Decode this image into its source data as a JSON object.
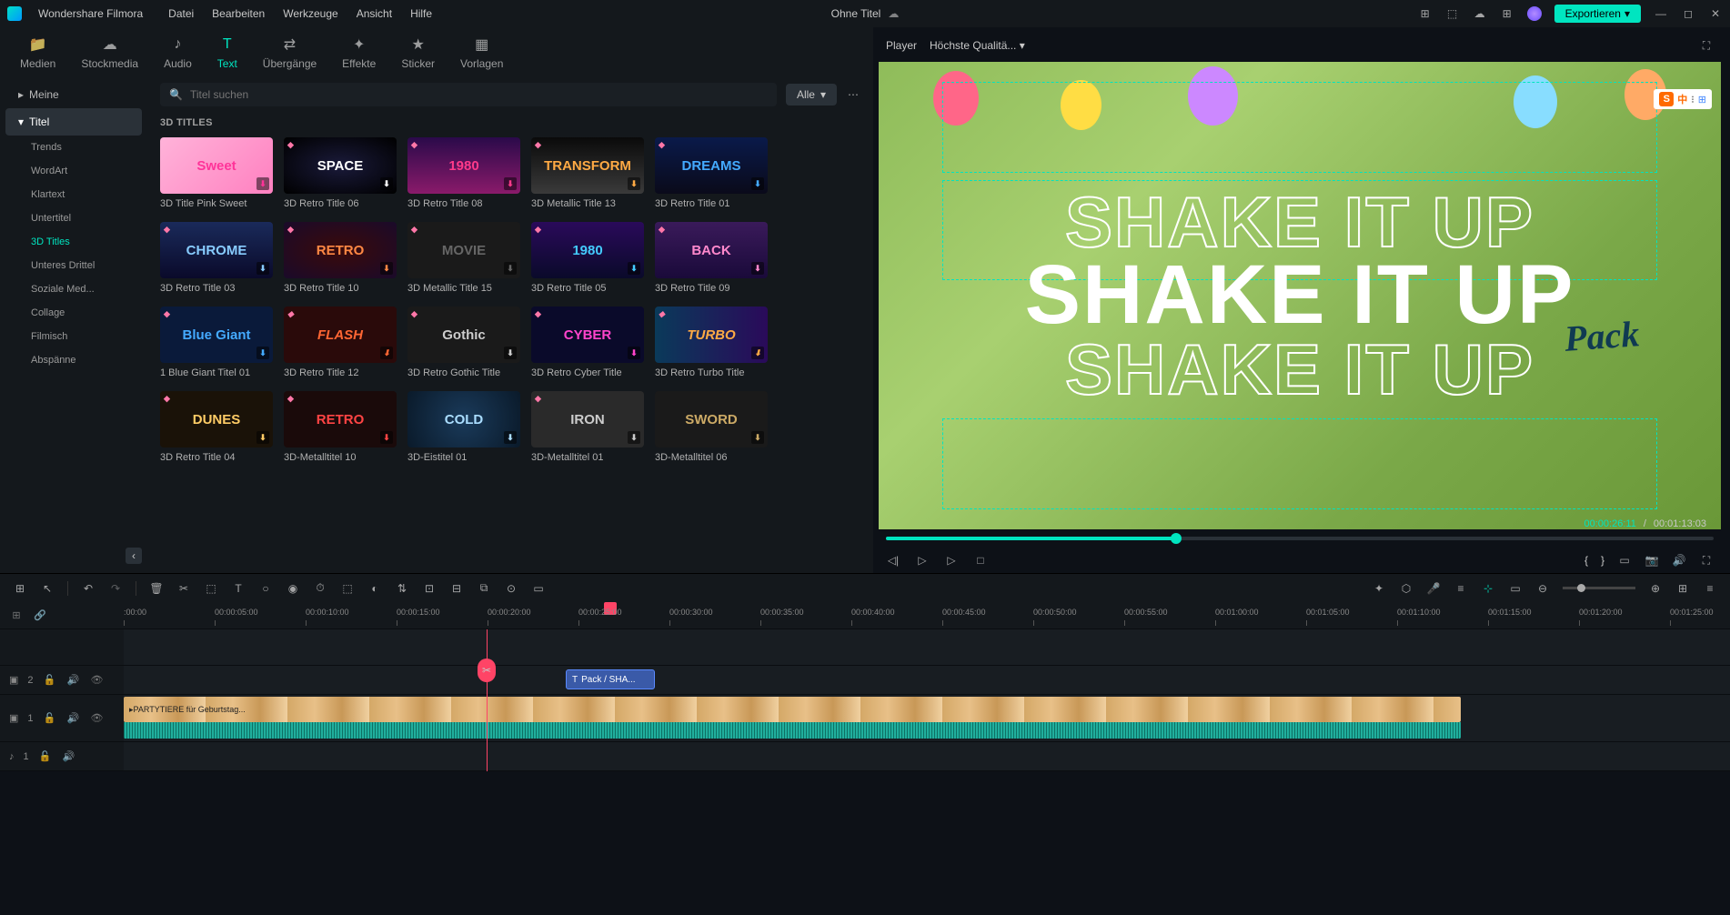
{
  "app_name": "Wondershare Filmora",
  "doc_title": "Ohne Titel",
  "menu": [
    "Datei",
    "Bearbeiten",
    "Werkzeuge",
    "Ansicht",
    "Hilfe"
  ],
  "export_label": "Exportieren",
  "tabs": [
    {
      "label": "Medien"
    },
    {
      "label": "Stockmedia"
    },
    {
      "label": "Audio"
    },
    {
      "label": "Text",
      "active": true
    },
    {
      "label": "Übergänge"
    },
    {
      "label": "Effekte"
    },
    {
      "label": "Sticker"
    },
    {
      "label": "Vorlagen"
    }
  ],
  "sidebar": {
    "top": [
      {
        "label": "Meine",
        "chev": "▸"
      },
      {
        "label": "Titel",
        "chev": "▾",
        "selected": true
      }
    ],
    "subs": [
      {
        "label": "Trends"
      },
      {
        "label": "WordArt"
      },
      {
        "label": "Klartext"
      },
      {
        "label": "Untertitel"
      },
      {
        "label": "3D Titles",
        "active": true
      },
      {
        "label": "Unteres Drittel"
      },
      {
        "label": "Soziale Med..."
      },
      {
        "label": "Collage"
      },
      {
        "label": "Filmisch"
      },
      {
        "label": "Abspänne"
      }
    ]
  },
  "search_placeholder": "Titel suchen",
  "filter_label": "Alle",
  "section_title": "3D TITLES",
  "titles": [
    {
      "label": "3D Title Pink Sweet",
      "txt": "Sweet",
      "cls": "g-pink"
    },
    {
      "label": "3D Retro Title 06",
      "txt": "SPACE",
      "cls": "g-space",
      "gem": true
    },
    {
      "label": "3D Retro Title 08",
      "txt": "1980",
      "cls": "g-retro80",
      "gem": true
    },
    {
      "label": "3D Metallic Title 13",
      "txt": "TRANSFORM",
      "cls": "g-metal",
      "gem": true
    },
    {
      "label": "3D Retro Title 01",
      "txt": "DREAMS",
      "cls": "g-dreams",
      "gem": true
    },
    {
      "label": "3D Retro Title 03",
      "txt": "CHROME",
      "cls": "g-chrome",
      "gem": true
    },
    {
      "label": "3D Retro Title 10",
      "txt": "RETRO",
      "cls": "g-retro",
      "gem": true
    },
    {
      "label": "3D Metallic Title 15",
      "txt": "MOVIE",
      "cls": "g-movie",
      "gem": true
    },
    {
      "label": "3D Retro Title 05",
      "txt": "1980",
      "cls": "g-1980",
      "gem": true
    },
    {
      "label": "3D Retro Title 09",
      "txt": "BACK",
      "cls": "g-back",
      "gem": true
    },
    {
      "label": "1 Blue Giant Titel 01",
      "txt": "Blue Giant",
      "cls": "g-blue",
      "gem": true
    },
    {
      "label": "3D Retro Title 12",
      "txt": "FLASH",
      "cls": "g-flash",
      "gem": true
    },
    {
      "label": "3D Retro Gothic Title",
      "txt": "Gothic",
      "cls": "g-gothic",
      "gem": true
    },
    {
      "label": "3D Retro Cyber Title",
      "txt": "CYBER",
      "cls": "g-cyber",
      "gem": true
    },
    {
      "label": "3D Retro Turbo Title",
      "txt": "TURBO",
      "cls": "g-turbo",
      "gem": true
    },
    {
      "label": "3D Retro Title 04",
      "txt": "DUNES",
      "cls": "g-dunes",
      "gem": true
    },
    {
      "label": "3D-Metalltitel 10",
      "txt": "RETRO",
      "cls": "g-retro2",
      "gem": true
    },
    {
      "label": "3D-Eistitel 01",
      "txt": "COLD",
      "cls": "g-cold"
    },
    {
      "label": "3D-Metalltitel 01",
      "txt": "IRON",
      "cls": "g-iron",
      "gem": true
    },
    {
      "label": "3D-Metalltitel 06",
      "txt": "SWORD",
      "cls": "g-sword"
    }
  ],
  "player": {
    "label": "Player",
    "quality": "Höchste Qualitä...",
    "text1": "SHAKE IT UP",
    "text2": "SHAKE IT UP",
    "text3": "SHAKE IT UP",
    "pack": "Pack",
    "ime": {
      "s": "S",
      "cn": "中"
    },
    "progress_pct": 35,
    "current_time": "00:00:26:11",
    "total_time": "00:01:13:03"
  },
  "timeline": {
    "ticks": [
      ":00:00",
      "00:00:05:00",
      "00:00:10:00",
      "00:00:15:00",
      "00:00:20:00",
      "00:00:25:00",
      "00:00:30:00",
      "00:00:35:00",
      "00:00:40:00",
      "00:00:45:00",
      "00:00:50:00",
      "00:00:55:00",
      "00:01:00:00",
      "00:01:05:00",
      "00:01:10:00",
      "00:01:15:00",
      "00:01:20:00",
      "00:01:25:00"
    ],
    "tracks": {
      "video2": {
        "icon": "▣",
        "num": "2"
      },
      "video1": {
        "icon": "▣",
        "num": "1"
      },
      "audio1": {
        "icon": "♪",
        "num": "1"
      }
    },
    "text_clip": "Pack / SHA...",
    "video_clip": "PARTYTIERE für Geburtstag..."
  }
}
